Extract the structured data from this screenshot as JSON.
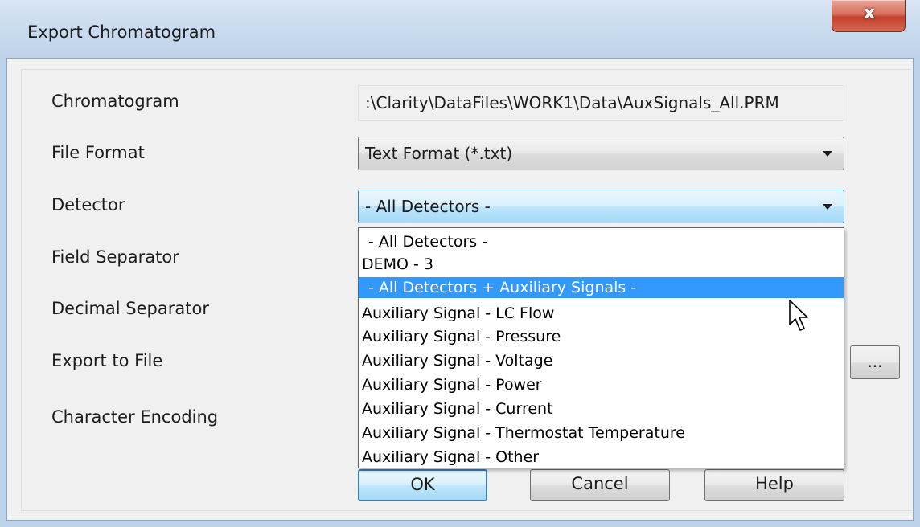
{
  "window": {
    "title": "Export Chromatogram",
    "close_glyph": "x"
  },
  "form": {
    "chromatogram_label": "Chromatogram",
    "chromatogram_value": ":\\Clarity\\DataFiles\\WORK1\\Data\\AuxSignals_All.PRM",
    "file_format_label": "File Format",
    "file_format_value": "Text Format (*.txt)",
    "detector_label": "Detector",
    "detector_value": "- All Detectors -",
    "field_separator_label": "Field Separator",
    "decimal_separator_label": "Decimal Separator",
    "export_to_file_label": "Export to File",
    "browse_label": "...",
    "character_encoding_label": "Character Encoding"
  },
  "detector_options": [
    "- All Detectors -",
    "DEMO - 3",
    "- All Detectors + Auxiliary Signals -",
    "Auxiliary Signal - LC Flow",
    "Auxiliary Signal - Pressure",
    "Auxiliary Signal - Voltage",
    "Auxiliary Signal - Power",
    "Auxiliary Signal - Current",
    "Auxiliary Signal - Thermostat Temperature",
    "Auxiliary Signal - Other"
  ],
  "highlighted_option_index": 2,
  "buttons": {
    "ok": "OK",
    "cancel": "Cancel",
    "help": "Help"
  },
  "icons": {
    "close": "close-icon",
    "dropdown": "chevron-down-icon",
    "cursor": "mouse-pointer-icon"
  },
  "colors": {
    "selection": "#3399ff",
    "default_button_border": "#3c7fb1",
    "close_button": "#c4402a"
  }
}
